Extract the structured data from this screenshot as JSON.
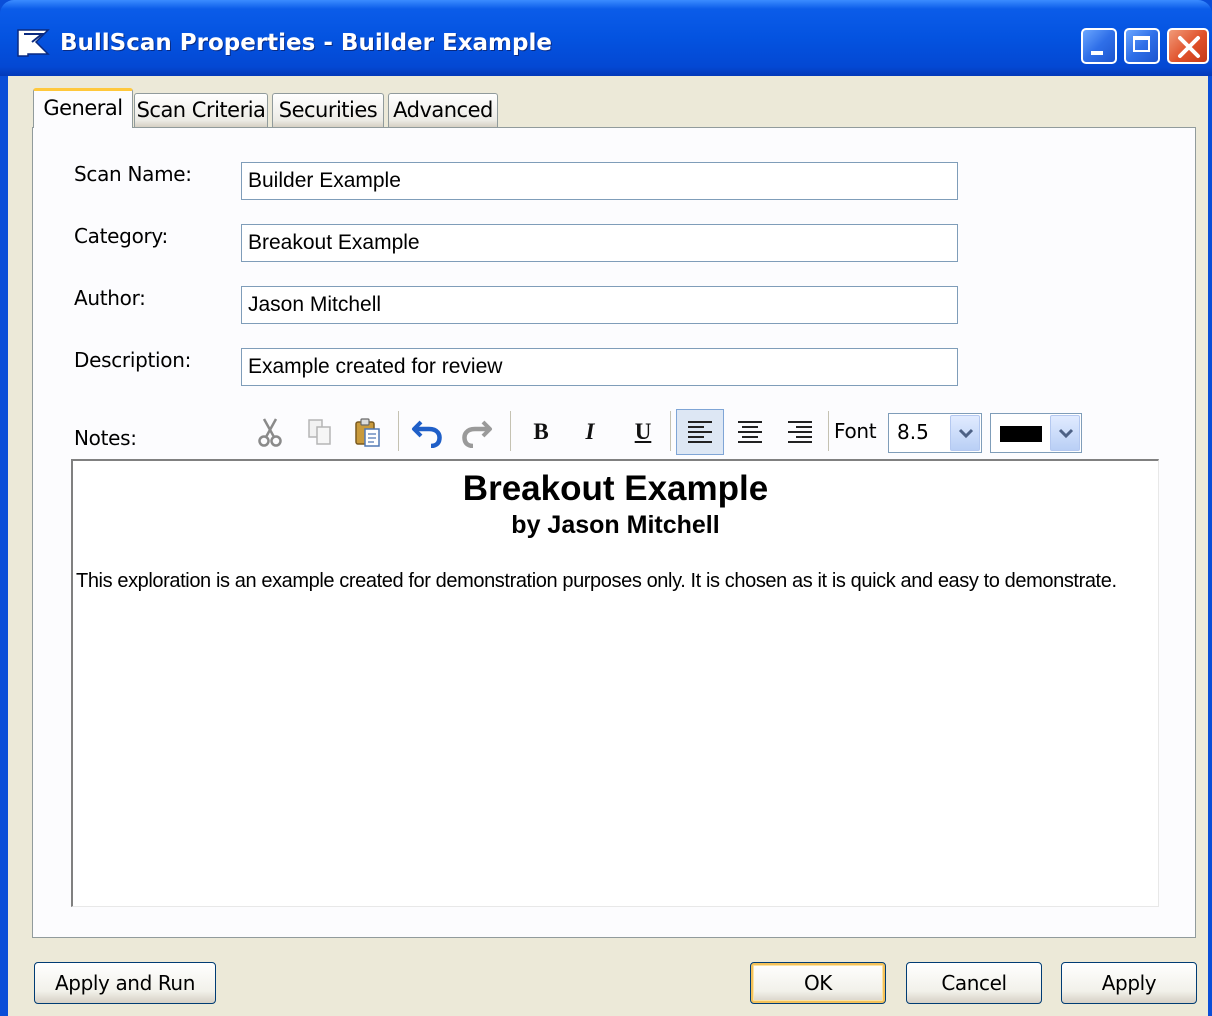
{
  "window": {
    "title": "BullScan Properties - Builder Example",
    "icon": "bullscan-flag-icon"
  },
  "tabs": [
    {
      "label": "General",
      "active": true
    },
    {
      "label": "Scan Criteria",
      "active": false
    },
    {
      "label": "Securities",
      "active": false
    },
    {
      "label": "Advanced",
      "active": false
    }
  ],
  "form": {
    "scan_name": {
      "label": "Scan Name:",
      "value": "Builder Example"
    },
    "category": {
      "label": "Category:",
      "value": "Breakout Example"
    },
    "author": {
      "label": "Author:",
      "value": "Jason Mitchell"
    },
    "description": {
      "label": "Description:",
      "value": "Example created for review"
    }
  },
  "notes": {
    "label": "Notes:",
    "toolbar": {
      "bold": "B",
      "italic": "I",
      "underline": "U",
      "font_label": "Font",
      "font_size": "8.5",
      "color": "#000000"
    },
    "title": "Breakout Example",
    "subtitle": "by Jason Mitchell",
    "body": "This exploration is an example created for demonstration purposes only. It is chosen as it is quick and easy to demonstrate."
  },
  "buttons": {
    "apply_run": "Apply and Run",
    "ok": "OK",
    "cancel": "Cancel",
    "apply": "Apply"
  },
  "colors": {
    "titlebar": "#0453e0",
    "dialog_bg": "#ece9d8",
    "active_tab_highlight": "#ffc83c"
  }
}
